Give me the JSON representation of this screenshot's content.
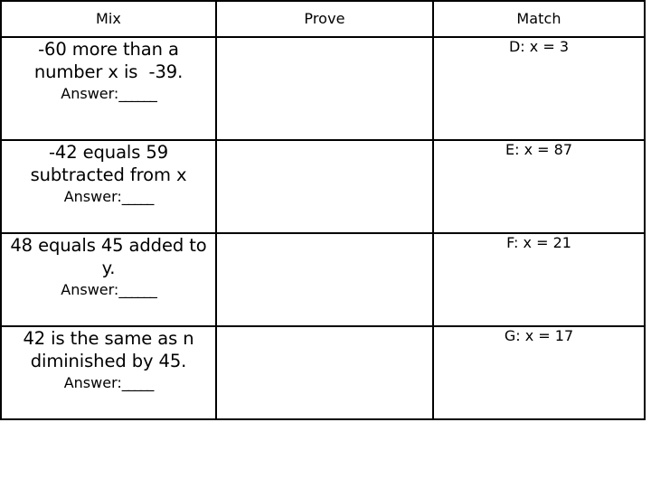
{
  "worksheet": {
    "columns": [
      {
        "id": "mix",
        "label": "Mix"
      },
      {
        "id": "prove",
        "label": "Prove"
      },
      {
        "id": "match",
        "label": "Match"
      }
    ],
    "rows": [
      {
        "problem": "-60 more than a number x is  -39.",
        "answer_label": "Answer:",
        "answer_blank": "______",
        "prove": "",
        "match": "D: x = 3"
      },
      {
        "problem": "-42 equals 59 subtracted from x",
        "answer_label": "Answer:",
        "answer_blank": "_____",
        "prove": "",
        "match": "E: x = 87"
      },
      {
        "problem": "48 equals 45 added to y.",
        "answer_label": "Answer:",
        "answer_blank": "______",
        "prove": "",
        "match": "F: x = 21"
      },
      {
        "problem": "42 is the same as n diminished by 45.",
        "answer_label": "Answer:",
        "answer_blank": "_____",
        "prove": "",
        "match": "G: x = 17"
      }
    ]
  },
  "colors": {
    "background": "#ffffff",
    "border": "#000000",
    "text": "#000000"
  }
}
